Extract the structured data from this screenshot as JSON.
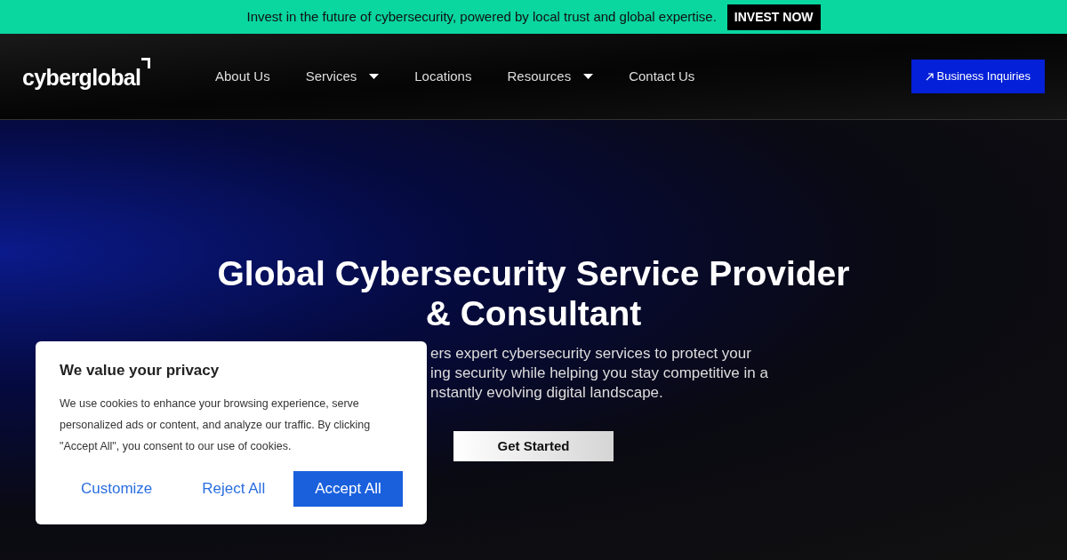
{
  "banner": {
    "text": "Invest in the future of cybersecurity, powered by local trust and global expertise.",
    "button": "INVEST NOW"
  },
  "nav": {
    "logo": "cyberglobal",
    "items": [
      {
        "label": "About Us",
        "dropdown": false
      },
      {
        "label": "Services",
        "dropdown": true
      },
      {
        "label": "Locations",
        "dropdown": false
      },
      {
        "label": "Resources",
        "dropdown": true
      },
      {
        "label": "Contact Us",
        "dropdown": false
      }
    ],
    "cta": "Business Inquiries"
  },
  "hero": {
    "title_lines": [
      "Global Cybersecurity Service Provider",
      "& Consultant"
    ],
    "subtitle_lines": [
      "ers expert cybersecurity services to protect your",
      "ing security while helping you stay competitive in a",
      "nstantly evolving digital landscape."
    ],
    "button": "Get Started"
  },
  "cookie_dialog": {
    "title": "We value your privacy",
    "text": "We use cookies to enhance your browsing experience, serve personalized ads or content, and analyze our traffic. By clicking \"Accept All\", you consent to our use of cookies.",
    "buttons": [
      {
        "label": "Customize",
        "kind": "link"
      },
      {
        "label": "Reject All",
        "kind": "link"
      },
      {
        "label": "Accept All",
        "kind": "primary"
      }
    ]
  }
}
